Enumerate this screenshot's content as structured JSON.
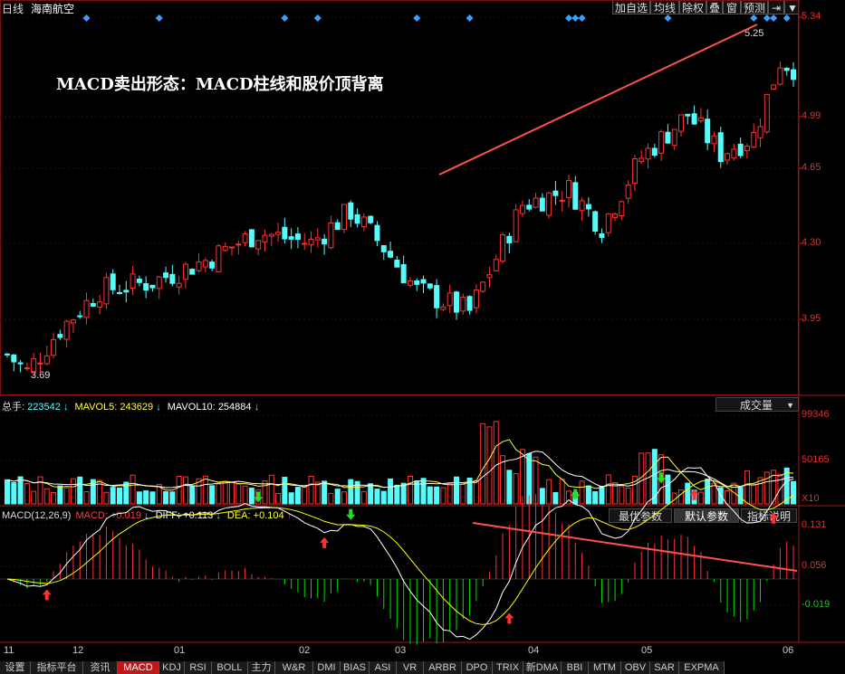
{
  "header": {
    "period": "日线",
    "stock_name": "海南航空",
    "buttons": [
      "加自选",
      "均线",
      "除权",
      "叠",
      "窗",
      "预测",
      "⇥",
      "▼"
    ]
  },
  "annotation": "MACD卖出形态：MACD柱线和股价顶背离",
  "price_panel": {
    "y_ticks": [
      "5.34",
      "4.99",
      "4.65",
      "4.30",
      "3.95"
    ],
    "high_label": "5.25",
    "low_label": "3.69"
  },
  "volume_panel": {
    "legend": {
      "total_label": "总手:",
      "total_value": "223542",
      "mavol5_label": "MAVOL5:",
      "mavol5_value": "243629",
      "mavol10_label": "MAVOL10:",
      "mavol10_value": "254884"
    },
    "selector": "成交量",
    "y_ticks": [
      "99346",
      "50165"
    ],
    "multiplier": "X10"
  },
  "macd_panel": {
    "legend": {
      "name": "MACD(12,26,9)",
      "macd_label": "MACD:",
      "macd_value": "+0.019",
      "diff_label": "DIFF:",
      "diff_value": "+0.113",
      "dea_label": "DEA:",
      "dea_value": "+0.104"
    },
    "buttons": [
      "最优参数",
      "默认参数",
      "指标说明"
    ],
    "y_ticks": [
      "0.131",
      "0.056",
      "-0.019"
    ]
  },
  "date_axis": [
    "11",
    "12",
    "01",
    "02",
    "03",
    "04",
    "05",
    "06"
  ],
  "tabs": [
    "设置",
    "指标平台",
    "资讯",
    "MACD",
    "KDJ",
    "RSI",
    "BOLL",
    "主力",
    "W&R",
    "DMI",
    "BIAS",
    "ASI",
    "VR",
    "ARBR",
    "DPO",
    "TRIX",
    "新DMA",
    "BBI",
    "MTM",
    "OBV",
    "SAR",
    "EXPMA"
  ],
  "active_tab": "MACD",
  "colors": {
    "up": "#ff3232",
    "down": "#54fcfc",
    "diff_line": "#ffffff",
    "dea_line": "#ffff00",
    "trend_line": "#ff5050",
    "macd_pos": "#ff3232",
    "macd_neg": "#00e000"
  },
  "chart_data": [
    {
      "type": "candlestick",
      "title": "海南航空 日线",
      "x_range": [
        "11",
        "06"
      ],
      "ylim": [
        3.69,
        5.34
      ],
      "annotations": [
        {
          "type": "trendline",
          "direction": "rising",
          "over": "price highs 04–06"
        },
        {
          "label": "5.25",
          "kind": "high"
        },
        {
          "label": "3.69",
          "kind": "low"
        }
      ]
    },
    {
      "type": "bar",
      "title": "成交量",
      "series": [
        {
          "name": "总手",
          "last": 223542
        },
        {
          "name": "MAVOL5",
          "last": 243629
        },
        {
          "name": "MAVOL10",
          "last": 254884
        }
      ],
      "y_ticks": [
        99346,
        50165
      ]
    },
    {
      "type": "line",
      "title": "MACD(12,26,9)",
      "series": [
        {
          "name": "MACD",
          "last": 0.019
        },
        {
          "name": "DIFF",
          "last": 0.113
        },
        {
          "name": "DEA",
          "last": 0.104
        }
      ],
      "y_ticks": [
        0.131,
        0.056,
        -0.019
      ],
      "annotations": [
        {
          "type": "trendline",
          "direction": "falling",
          "over": "MACD histogram peaks 04–06"
        }
      ]
    }
  ]
}
